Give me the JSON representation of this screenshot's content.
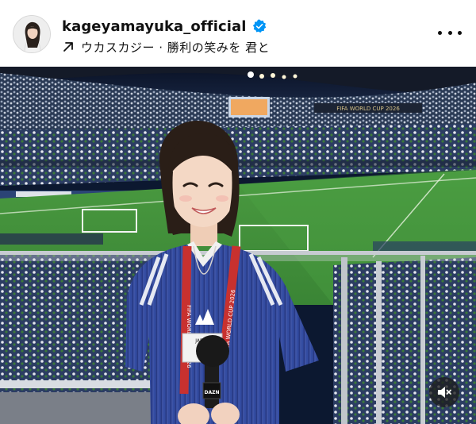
{
  "post": {
    "username": "kageyamayuka_official",
    "verified": true,
    "audio_track": "ウカスカジー · 勝利の笑みを 君と",
    "avatar_icon": "profile-avatar",
    "more_icon": "more-horizontal-icon",
    "verified_icon": "verified-badge-icon",
    "audio_icon": "arrow-up-right-icon"
  },
  "photo": {
    "stadium_banner": "FIFA WORLD CUP 2026",
    "lanyard_text": "FIFA WORLD CUP 2026",
    "credential_text": "JAPAN",
    "mic_label": "DAZN",
    "mute_icon": "speaker-muted-icon"
  },
  "colors": {
    "verified_blue": "#0095f6",
    "pitch_green": "#3f8f3a",
    "jersey_blue": "#2b3f8f",
    "lanyard_red": "#c8312f"
  }
}
